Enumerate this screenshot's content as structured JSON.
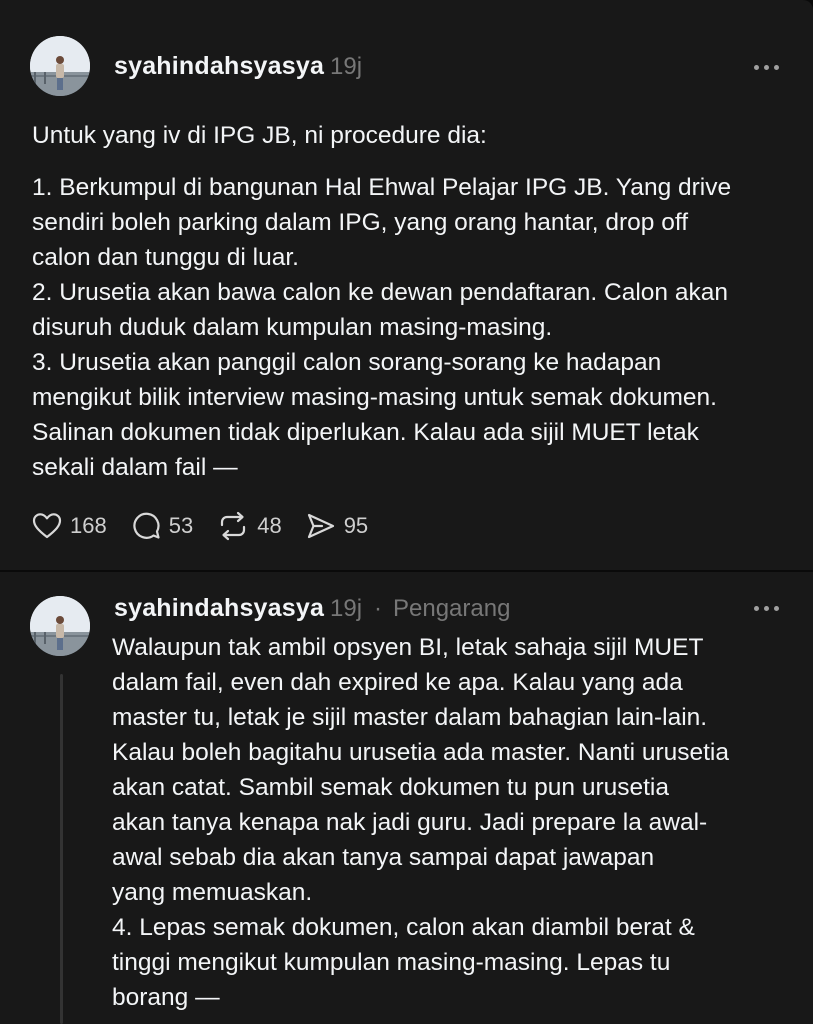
{
  "post": {
    "username": "syahindahsyasya",
    "time": "19j",
    "paragraph1": "Untuk yang iv di IPG JB, ni procedure dia:",
    "paragraph2": "1. Berkumpul di bangunan Hal Ehwal Pelajar IPG JB. Yang drive\nsendiri boleh parking dalam IPG, yang orang hantar, drop off\ncalon dan tunggu di luar.\n2. Urusetia akan bawa calon ke dewan pendaftaran. Calon akan\ndisuruh duduk dalam kumpulan masing-masing.\n3. Urusetia akan panggil calon sorang-sorang ke hadapan\nmengikut bilik interview masing-masing untuk semak dokumen.\nSalinan dokumen tidak diperlukan. Kalau ada sijil MUET letak\nsekali dalam fail —",
    "likes": "168",
    "replies": "53",
    "reposts": "48",
    "shares": "95"
  },
  "reply": {
    "username": "syahindahsyasya",
    "time": "19j",
    "separator": "·",
    "badge": "Pengarang",
    "text": "Walaupun tak ambil opsyen BI, letak sahaja sijil MUET\ndalam fail, even dah expired ke apa. Kalau yang ada\nmaster tu, letak je sijil master dalam bahagian lain-lain.\nKalau boleh bagitahu urusetia ada master. Nanti urusetia\nakan catat. Sambil semak dokumen tu pun urusetia\nakan tanya kenapa nak jadi guru. Jadi prepare la awal-\nawal sebab dia akan tanya sampai dapat jawapan\nyang memuaskan.\n4. Lepas semak dokumen, calon akan diambil berat &\ntinggi mengikut kumpulan masing-masing. Lepas tu\nborang —"
  },
  "icons": {
    "like": "heart-icon",
    "reply": "comment-icon",
    "repost": "repost-icon",
    "share": "send-icon",
    "more": "more-horizontal-icon"
  },
  "colors": {
    "background": "#0a0a0a",
    "card": "#181818",
    "text": "#f3f5f7",
    "muted": "#777777"
  }
}
